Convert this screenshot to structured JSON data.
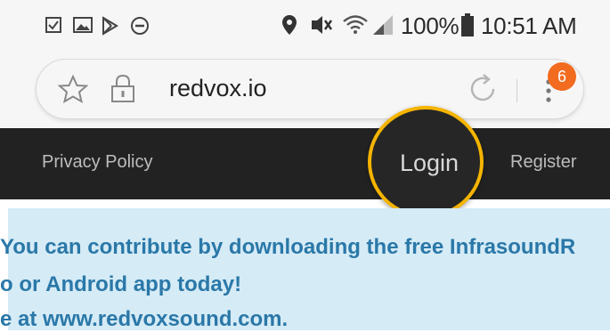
{
  "status_bar": {
    "battery_percent": "100%",
    "time": "10:51 AM",
    "icons": [
      "checklist-icon",
      "gallery-icon",
      "play-store-icon",
      "do-not-disturb-icon",
      "location-icon",
      "vibrate-mute-icon",
      "wifi-icon",
      "signal-icon",
      "battery-icon"
    ]
  },
  "browser": {
    "url": "redvox.io",
    "tab_badge_count": "6",
    "icons": [
      "star-icon",
      "lock-icon",
      "reload-icon",
      "menu-icon"
    ]
  },
  "nav": {
    "privacy_label": "Privacy Policy",
    "login_label": "Login",
    "register_label": "Register"
  },
  "banner": {
    "line1": "You can contribute by downloading the free InfrasoundR",
    "line2": "o or Android app today!",
    "line3": "e at www.redvoxsound.com."
  },
  "colors": {
    "nav_bg": "#222222",
    "highlight_ring": "#f5b400",
    "badge": "#f26b1f",
    "banner_bg": "#d5ebf6",
    "banner_text": "#2a78a8"
  }
}
